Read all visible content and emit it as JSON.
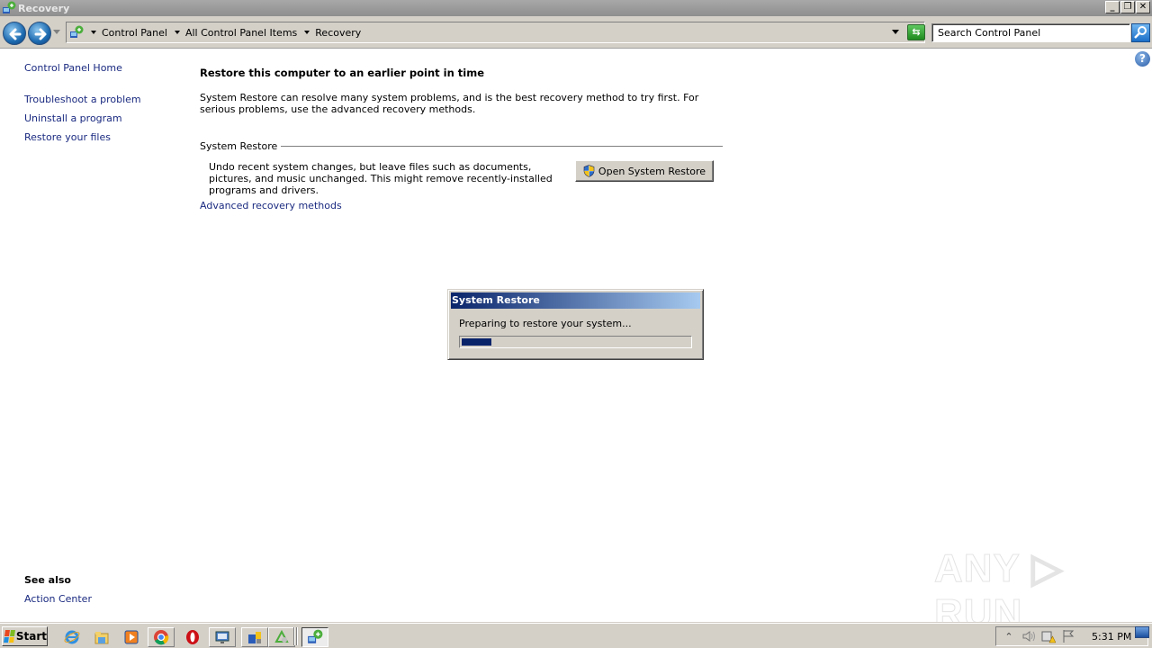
{
  "window": {
    "title": "Recovery",
    "controls": {
      "minimize": "_",
      "restore": "❐",
      "close": "✕"
    }
  },
  "navbar": {
    "back_icon": "back-arrow-icon",
    "forward_icon": "forward-arrow-icon",
    "breadcrumb": [
      "Control Panel",
      "All Control Panel Items",
      "Recovery"
    ],
    "refresh_label": "⇆",
    "search_placeholder": "Search Control Panel"
  },
  "help": {
    "label": "?"
  },
  "sidebar": {
    "home": "Control Panel Home",
    "links": [
      "Troubleshoot a problem",
      "Uninstall a program",
      "Restore your files"
    ],
    "see_also_heading": "See also",
    "see_also_links": [
      "Action Center"
    ]
  },
  "main": {
    "title": "Restore this computer to an earlier point in time",
    "description": "System Restore can resolve many system problems, and is the best recovery method to try first. For serious problems, use the advanced recovery methods.",
    "group_label": "System Restore",
    "group_description": "Undo recent system changes, but leave files such as documents, pictures, and music unchanged. This might remove recently-installed programs and drivers.",
    "open_button": "Open System Restore",
    "advanced_link": "Advanced recovery methods"
  },
  "dialog": {
    "title": "System Restore",
    "message": "Preparing to restore your system...",
    "progress_percent": 13,
    "progress_color": "#0a246a"
  },
  "watermark": {
    "text": "ANY ▷ RUN"
  },
  "taskbar": {
    "start_label": "Start",
    "pinned": [
      "internet-explorer-icon",
      "file-explorer-icon",
      "media-player-icon",
      "chrome-icon",
      "opera-icon",
      "remote-desktop-icon",
      "control-panel-icon",
      "recycle-tool-icon"
    ],
    "active_window": "recovery-window-icon",
    "clock": "5:31 PM"
  }
}
